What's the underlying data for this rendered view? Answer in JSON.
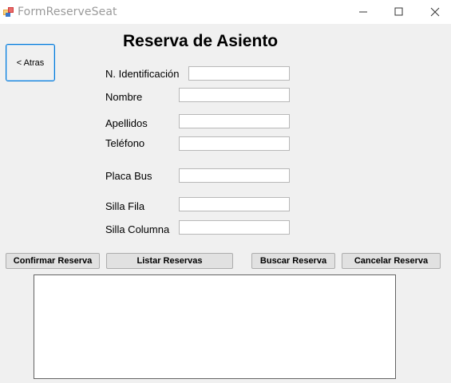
{
  "window": {
    "title": "FormReserveSeat",
    "controls": {
      "minimize": "minimize-icon",
      "maximize": "maximize-icon",
      "close": "close-icon"
    }
  },
  "back_button": {
    "label": "< Atras"
  },
  "heading": "Reserva de Asiento",
  "form": {
    "fields": [
      {
        "label": "N. Identificación",
        "value": ""
      },
      {
        "label": "Nombre",
        "value": ""
      },
      {
        "label": "Apellidos",
        "value": ""
      },
      {
        "label": "Teléfono",
        "value": ""
      },
      {
        "label": "Placa Bus",
        "value": ""
      },
      {
        "label": "Silla Fila",
        "value": ""
      },
      {
        "label": "Silla Columna",
        "value": ""
      }
    ]
  },
  "buttons": {
    "confirm": "Confirmar Reserva",
    "list": "Listar Reservas",
    "search": "Buscar Reserva",
    "cancel": "Cancelar Reserva"
  },
  "results": {
    "items": []
  },
  "colors": {
    "focus_border": "#0078d7",
    "background": "#f0f0f0"
  }
}
